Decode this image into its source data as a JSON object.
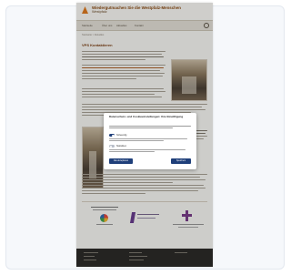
{
  "site": {
    "title": "Wiedergutmachen Sie die Westpfalz-Menschen",
    "subtitle": "Westpfalz"
  },
  "nav": {
    "items": [
      "Startseite",
      "Über uns",
      "Aktuelles",
      "Kontakt"
    ]
  },
  "breadcrumb": "Startseite > Aktuelles",
  "page": {
    "title": "VPS Kontaktieren"
  },
  "cookie_modal": {
    "title": "Datenschutz- und Cookieeinstellungen: Ihre Einwilligung",
    "option_1": "Notwendig",
    "option_2": "Statistiken",
    "accept_label": "Alle akzeptieren",
    "save_label": "Speichern"
  },
  "colors": {
    "brand": "#8b4c14",
    "logo_accent": "#e07a20",
    "modal_button": "#1f3f7a",
    "footer": "#2d2b29"
  },
  "icons": [
    "logo-icon",
    "search-icon",
    "toggle-switch"
  ]
}
